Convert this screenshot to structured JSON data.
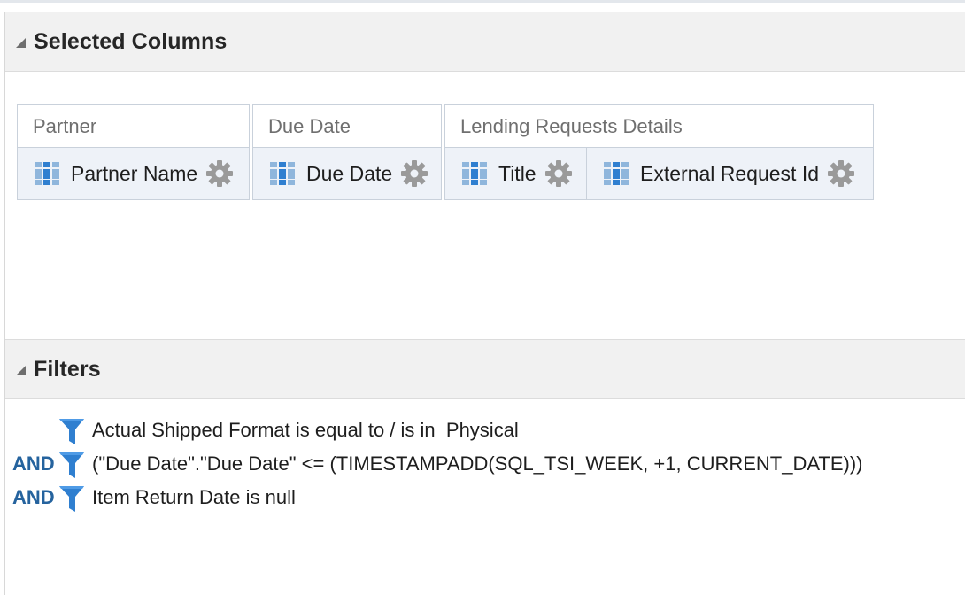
{
  "selected_columns": {
    "title": "Selected Columns",
    "groups": [
      {
        "name": "Partner",
        "columns": [
          {
            "label": "Partner Name"
          }
        ]
      },
      {
        "name": "Due Date",
        "columns": [
          {
            "label": "Due Date"
          }
        ]
      },
      {
        "name": "Lending Requests Details",
        "columns": [
          {
            "label": "Title"
          },
          {
            "label": "External Request Id"
          }
        ]
      }
    ]
  },
  "filters": {
    "title": "Filters",
    "rows": [
      {
        "connector": "",
        "field": "Actual Shipped Format",
        "operator": "is equal to / is in",
        "value": "Physical"
      },
      {
        "connector": "AND",
        "field": "(\"Due Date\".\"Due Date\" <= (TIMESTAMPADD(SQL_TSI_WEEK, +1, CURRENT_DATE)))",
        "operator": "",
        "value": ""
      },
      {
        "connector": "AND",
        "field": "Item Return Date",
        "operator": "is null",
        "value": ""
      }
    ]
  },
  "colors": {
    "accent_blue": "#25639e",
    "funnel_blue": "#2f7fd0",
    "header_bg": "#f1f1f1",
    "column_cell_bg": "#eef2f8"
  },
  "icons": {
    "collapse": "collapse-triangle-icon",
    "column": "column-grid-icon",
    "options": "gear-icon",
    "filter": "filter-funnel-icon"
  }
}
